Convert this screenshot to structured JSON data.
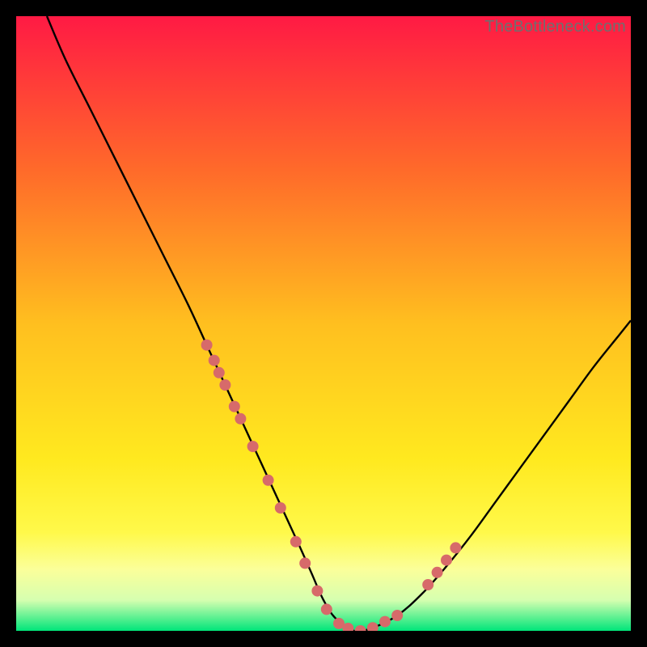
{
  "watermark": "TheBottleneck.com",
  "chart_data": {
    "type": "line",
    "title": "",
    "xlabel": "",
    "ylabel": "",
    "xlim": [
      0,
      100
    ],
    "ylim": [
      0,
      100
    ],
    "grid": false,
    "legend": false,
    "background_gradient": {
      "stops": [
        {
          "offset": 0.0,
          "color": "#ff1a44"
        },
        {
          "offset": 0.25,
          "color": "#ff6a2a"
        },
        {
          "offset": 0.5,
          "color": "#ffbf1f"
        },
        {
          "offset": 0.72,
          "color": "#ffe91f"
        },
        {
          "offset": 0.84,
          "color": "#fff94a"
        },
        {
          "offset": 0.9,
          "color": "#fbff9a"
        },
        {
          "offset": 0.95,
          "color": "#d6ffb0"
        },
        {
          "offset": 1.0,
          "color": "#00e57a"
        }
      ]
    },
    "series": [
      {
        "name": "curve",
        "color": "#000000",
        "x": [
          5,
          8,
          12,
          16,
          20,
          24,
          28,
          31,
          34,
          37,
          40,
          43,
          46,
          48,
          50,
          52,
          55,
          58,
          62,
          66,
          70,
          74,
          78,
          82,
          86,
          90,
          94,
          98,
          100
        ],
        "y": [
          100,
          93,
          85,
          77,
          69,
          61,
          53,
          46.5,
          40,
          33.5,
          27,
          20.5,
          14,
          9.5,
          5,
          2,
          0,
          0.5,
          2.5,
          6,
          10.5,
          15.5,
          21,
          26.5,
          32,
          37.5,
          43,
          48,
          50.5
        ]
      }
    ],
    "scatter": {
      "name": "dots",
      "color": "#d76a6a",
      "radius": 7,
      "points": [
        {
          "x": 31.0,
          "y": 46.5
        },
        {
          "x": 32.2,
          "y": 44.0
        },
        {
          "x": 33.0,
          "y": 42.0
        },
        {
          "x": 34.0,
          "y": 40.0
        },
        {
          "x": 35.5,
          "y": 36.5
        },
        {
          "x": 36.5,
          "y": 34.5
        },
        {
          "x": 38.5,
          "y": 30.0
        },
        {
          "x": 41.0,
          "y": 24.5
        },
        {
          "x": 43.0,
          "y": 20.0
        },
        {
          "x": 45.5,
          "y": 14.5
        },
        {
          "x": 47.0,
          "y": 11.0
        },
        {
          "x": 49.0,
          "y": 6.5
        },
        {
          "x": 50.5,
          "y": 3.5
        },
        {
          "x": 52.5,
          "y": 1.2
        },
        {
          "x": 54.0,
          "y": 0.4
        },
        {
          "x": 56.0,
          "y": 0.0
        },
        {
          "x": 58.0,
          "y": 0.5
        },
        {
          "x": 60.0,
          "y": 1.5
        },
        {
          "x": 62.0,
          "y": 2.5
        },
        {
          "x": 67.0,
          "y": 7.5
        },
        {
          "x": 68.5,
          "y": 9.5
        },
        {
          "x": 70.0,
          "y": 11.5
        },
        {
          "x": 71.5,
          "y": 13.5
        }
      ]
    }
  }
}
